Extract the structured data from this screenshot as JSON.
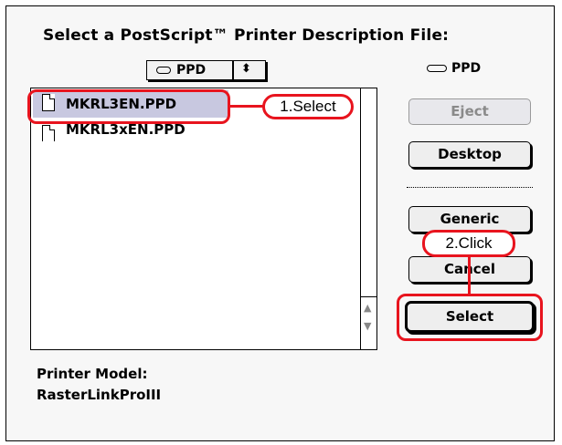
{
  "dialog": {
    "title": "Select a PostScript™ Printer Description File:",
    "folder_popup": {
      "label": "PPD",
      "arrows": "⬍"
    },
    "volume": {
      "label": "PPD"
    },
    "files": [
      {
        "name": "MKRL3EN.PPD",
        "selected": true
      },
      {
        "name": "MKRL3xEN.PPD",
        "selected": false
      }
    ],
    "buttons": {
      "eject": "Eject",
      "desktop": "Desktop",
      "generic": "Generic",
      "cancel": "Cancel",
      "select": "Select"
    },
    "printer_model": {
      "label": "Printer Model:",
      "value": "RasterLinkProIII"
    }
  },
  "annotations": {
    "step1": "1.Select",
    "step2": "2.Click",
    "color": "#e8141e"
  }
}
